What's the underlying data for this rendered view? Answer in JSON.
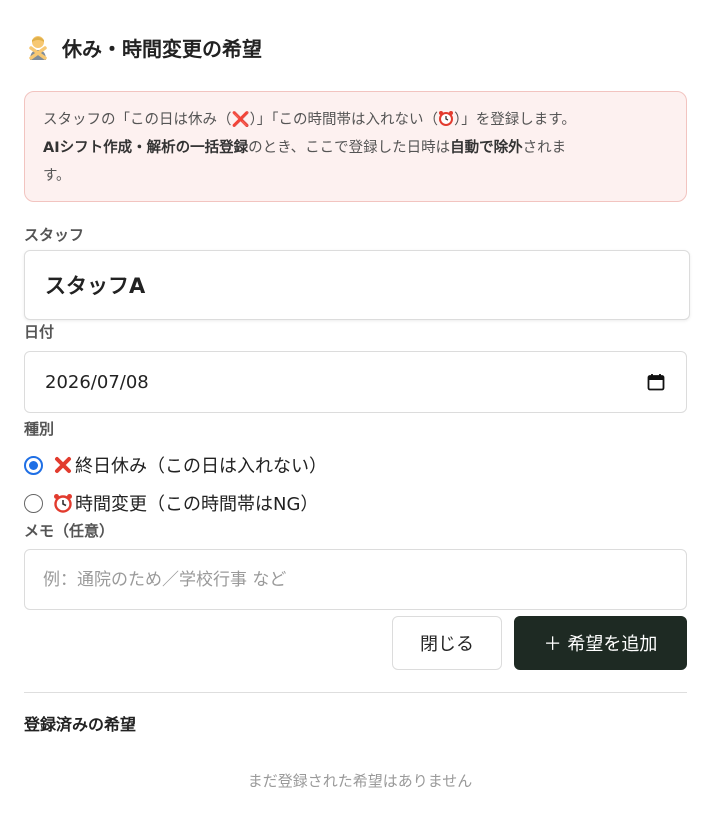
{
  "header": {
    "title": "休み・時間変更の希望",
    "icon": "person-gesturing-no-icon"
  },
  "notice": {
    "line1_a": "スタッフの「この日は休み（",
    "line1_x": "❌",
    "line1_b": "）」「この時間帯は入れない（",
    "line1_c": "）」を登録します。",
    "line2_bold": "AIシフト作成・解析の一括登録",
    "line2_a": "のとき、ここで登録した日時は",
    "line2_bold2": "自動で除外",
    "line2_b": "されま",
    "line3": "す。"
  },
  "staff": {
    "label": "スタッフ",
    "value": "スタッフA"
  },
  "date": {
    "label": "日付",
    "value": "2026/07/08",
    "icon": "calendar-icon"
  },
  "type": {
    "label": "種別",
    "options": [
      {
        "label": "終日休み（この日は入れない）",
        "icon": "cross-mark-icon",
        "selected": true
      },
      {
        "label": "時間変更（この時間帯はNG）",
        "icon": "alarm-clock-icon",
        "selected": false
      }
    ]
  },
  "memo": {
    "label": "メモ（任意）",
    "placeholder": "例：通院のため／学校行事 など",
    "value": ""
  },
  "buttons": {
    "close": "閉じる",
    "add": "＋ 希望を追加"
  },
  "registered": {
    "title": "登録済みの希望",
    "empty": "まだ登録された希望はありません"
  },
  "colors": {
    "accent": "#1f6fe5",
    "primary_button": "#1e2a23",
    "notice_bg": "#fdf1f0",
    "notice_border": "#f2c4c0"
  }
}
